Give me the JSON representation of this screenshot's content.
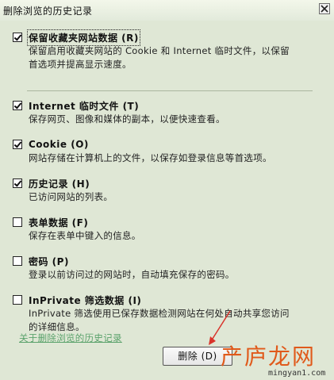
{
  "window": {
    "title": "删除浏览的历史记录",
    "close_icon": "close-icon"
  },
  "options": [
    {
      "label": "保留收藏夹网站数据 (R)",
      "checked": true,
      "desc1": "保留启用收藏夹网站的 Cookie 和 Internet 临时文件，以保留",
      "desc2": "首选项并提高显示速度。"
    },
    {
      "label": "Internet 临时文件 (T)",
      "checked": true,
      "desc1": "保存网页、图像和媒体的副本，以便快速查看。"
    },
    {
      "label": "Cookie (O)",
      "checked": true,
      "desc1": "网站存储在计算机上的文件，以保存如登录信息等首选项。"
    },
    {
      "label": "历史记录 (H)",
      "checked": true,
      "desc1": "已访问网站的列表。"
    },
    {
      "label": "表单数据 (F)",
      "checked": false,
      "desc1": "保存在表单中键入的信息。"
    },
    {
      "label": "密码 (P)",
      "checked": false,
      "desc1": "登录以前访问过的网站时，自动填充保存的密码。"
    },
    {
      "label": "InPrivate 筛选数据 (I)",
      "checked": false,
      "desc1": "InPrivate 筛选使用已保存数据检测网站在何处自动共享您访问",
      "desc2": "的详细信息。"
    }
  ],
  "footer": {
    "about_link": "关于删除浏览的历史记录",
    "delete_button": "删除 (D)"
  },
  "watermark": {
    "text": "产庐龙网",
    "url": "mingyan1.com"
  },
  "colors": {
    "background": "#dfe7d5",
    "link": "#5aa26b",
    "arrow": "#d9342b",
    "watermark": "#e05a1b"
  }
}
